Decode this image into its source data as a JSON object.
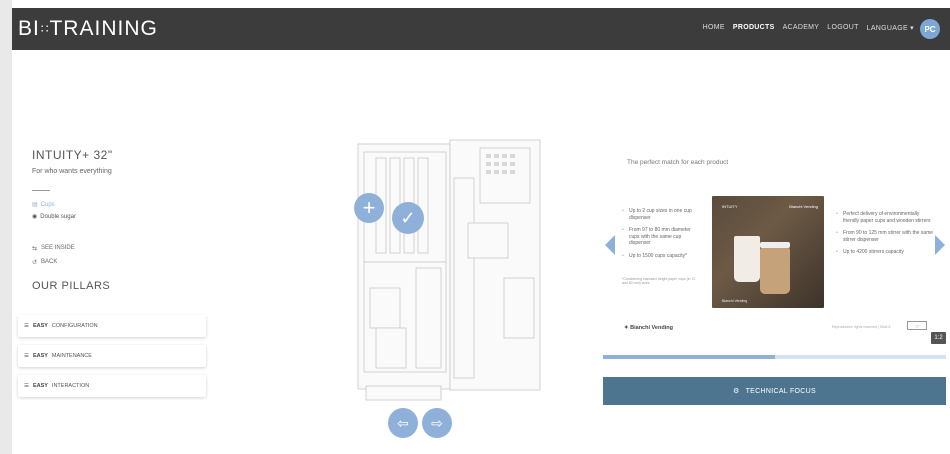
{
  "header": {
    "logo_left": "BI",
    "logo_dots": "∷",
    "logo_right": "TRAINING",
    "nav": [
      "HOME",
      "PRODUCTS",
      "ACADEMY",
      "LOGOUT",
      "LANGUAGE ▾"
    ],
    "active_nav": "PRODUCTS",
    "avatar_initials": "PC"
  },
  "product": {
    "title": "INTUITY+ 32\"",
    "subtitle": "For who wants everything",
    "options": [
      {
        "icon": "cups-icon",
        "label": "Cups"
      },
      {
        "icon": "sugar-icon",
        "label": "Double sugar"
      }
    ],
    "links": [
      {
        "icon": "see-inside-icon",
        "label": "SEE INSIDE"
      },
      {
        "icon": "back-icon",
        "label": "BACK"
      }
    ]
  },
  "pillars": {
    "title": "OUR PILLARS",
    "items": [
      {
        "bold": "EASY",
        "rest": "CONFIGURATION"
      },
      {
        "bold": "EASY",
        "rest": "MAINTENANCE"
      },
      {
        "bold": "EASY",
        "rest": "INTERACTION"
      }
    ]
  },
  "slide": {
    "headline": "The perfect match for each product",
    "left_bullets": [
      "Up to 2 cup sizes in one cup dispenser",
      "From 97 to 80 mm diameter cups with the same cup dispenser",
      "Up to 1500 cups capacity*"
    ],
    "footnote": "*Considering standard-height paper cups (in 72 and 80 mm) sizes",
    "right_bullets": [
      "Perfect delivery of environmentally friendly paper cups and wooden stirrers",
      "From 90 to 125 mm stirrer with the same stirrer dispenser",
      "Up to 4200 stirrers capacity"
    ],
    "photo_brand": "Bianchi Vending",
    "photo_tag": "INTUITY",
    "bottom_logo": "Bianchi Vending",
    "small_note": "Reproduction rights reserved | Slide 8",
    "zoom_label": "1:2",
    "progress": 0.5
  },
  "tech_focus": {
    "icon": "gears-icon",
    "label": "TECHNICAL FOCUS"
  },
  "colors": {
    "accent": "#8fb0d8",
    "topbar": "#3c3c3c",
    "tech_button": "#4e7590"
  }
}
